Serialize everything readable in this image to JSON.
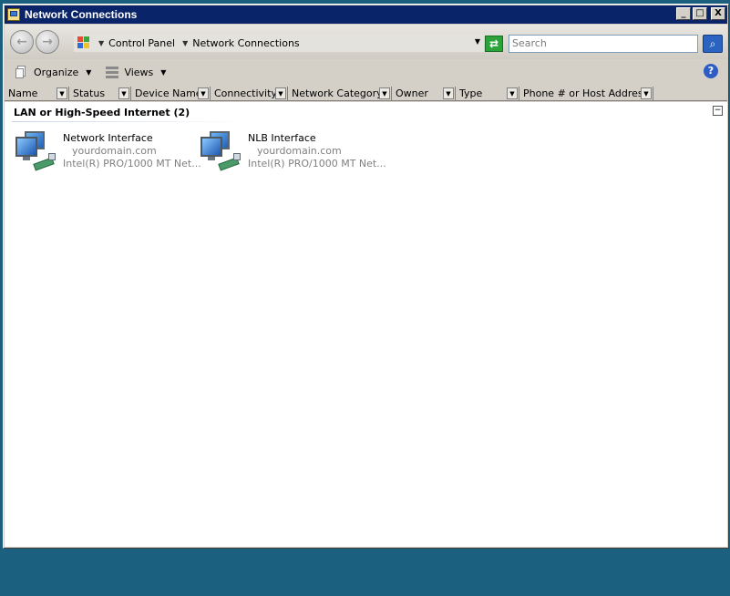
{
  "window": {
    "title": "Network Connections",
    "controls": {
      "minimize": "_",
      "maximize": "□",
      "close": "X"
    }
  },
  "addressbar": {
    "breadcrumb": [
      "Control Panel",
      "Network Connections"
    ],
    "search_placeholder": "Search"
  },
  "toolbar": {
    "organize_label": "Organize",
    "views_label": "Views",
    "help_glyph": "?"
  },
  "columns": [
    "Name",
    "Status",
    "Device Name",
    "Connectivity",
    "Network Category",
    "Owner",
    "Type",
    "Phone # or Host Address"
  ],
  "group": {
    "title": "LAN or High-Speed Internet (2)",
    "collapse_glyph": "−"
  },
  "items": [
    {
      "name": "Network Interface",
      "domain": "yourdomain.com",
      "adapter": "Intel(R) PRO/1000 MT Net..."
    },
    {
      "name": "NLB Interface",
      "domain": "yourdomain.com",
      "adapter": "Intel(R) PRO/1000 MT Net..."
    }
  ],
  "colors": {
    "titlebar": "#0a246a",
    "desktop": "#1b5e7e",
    "chrome": "#d4d0c8"
  }
}
